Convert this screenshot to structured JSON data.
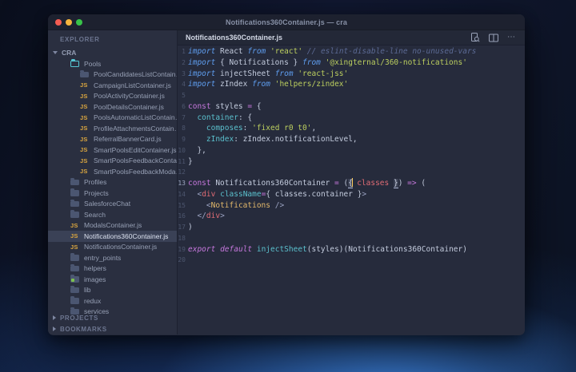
{
  "window": {
    "title": "Notifications360Container.js — cra"
  },
  "sidebar": {
    "header": "EXPLORER",
    "root": "CRA",
    "items": [
      {
        "label": "Pools",
        "icon": "folder-open",
        "level": 3
      },
      {
        "label": "PoolCandidatesListContain…",
        "icon": "folder",
        "level": 4
      },
      {
        "label": "CampaignListContainer.js",
        "icon": "js",
        "level": 4
      },
      {
        "label": "PoolActivityContainer.js",
        "icon": "js",
        "level": 4
      },
      {
        "label": "PoolDetailsContainer.js",
        "icon": "js",
        "level": 4
      },
      {
        "label": "PoolsAutomaticListContain…",
        "icon": "js",
        "level": 4
      },
      {
        "label": "ProfileAttachmentsContain…",
        "icon": "js",
        "level": 4
      },
      {
        "label": "ReferralBannerCard.js",
        "icon": "js",
        "level": 4
      },
      {
        "label": "SmartPoolsEditContainer.js",
        "icon": "js",
        "level": 4
      },
      {
        "label": "SmartPoolsFeedbackConta…",
        "icon": "js",
        "level": 4
      },
      {
        "label": "SmartPoolsFeedbackModa…",
        "icon": "js",
        "level": 4
      },
      {
        "label": "Profiles",
        "icon": "folder",
        "level": 3
      },
      {
        "label": "Projects",
        "icon": "folder",
        "level": 3
      },
      {
        "label": "SalesforceChat",
        "icon": "folder",
        "level": 3
      },
      {
        "label": "Search",
        "icon": "folder",
        "level": 3
      },
      {
        "label": "ModalsContainer.js",
        "icon": "js",
        "level": 3
      },
      {
        "label": "Notifications360Container.js",
        "icon": "js",
        "level": 3,
        "selected": true
      },
      {
        "label": "NotificationsContainer.js",
        "icon": "js",
        "level": 3
      },
      {
        "label": "entry_points",
        "icon": "folder",
        "level": 2
      },
      {
        "label": "helpers",
        "icon": "folder",
        "level": 2
      },
      {
        "label": "images",
        "icon": "folder-image",
        "level": 2
      },
      {
        "label": "lib",
        "icon": "folder",
        "level": 2
      },
      {
        "label": "redux",
        "icon": "folder",
        "level": 2
      },
      {
        "label": "services",
        "icon": "folder",
        "level": 2
      }
    ],
    "sections": [
      {
        "label": "PROJECTS"
      },
      {
        "label": "BOOKMARKS"
      }
    ]
  },
  "tabbar": {
    "tab": "Notifications360Container.js",
    "more_icon_glyph": "⋯"
  },
  "editor": {
    "active_line": 13,
    "lines": [
      {
        "num": 1,
        "tokens": [
          [
            "kw",
            "import"
          ],
          [
            "plain",
            " React "
          ],
          [
            "kw",
            "from"
          ],
          [
            "plain",
            " "
          ],
          [
            "str",
            "'react'"
          ],
          [
            "plain",
            " "
          ],
          [
            "com",
            "// eslint-disable-line no-unused-vars"
          ]
        ]
      },
      {
        "num": 2,
        "tokens": [
          [
            "kw",
            "import"
          ],
          [
            "plain",
            " { Notifications } "
          ],
          [
            "kw",
            "from"
          ],
          [
            "plain",
            " "
          ],
          [
            "str",
            "'@xingternal/360-notifications'"
          ]
        ]
      },
      {
        "num": 3,
        "tokens": [
          [
            "kw",
            "import"
          ],
          [
            "plain",
            " injectSheet "
          ],
          [
            "kw",
            "from"
          ],
          [
            "plain",
            " "
          ],
          [
            "str",
            "'react-jss'"
          ]
        ]
      },
      {
        "num": 4,
        "tokens": [
          [
            "kw",
            "import"
          ],
          [
            "plain",
            " zIndex "
          ],
          [
            "kw",
            "from"
          ],
          [
            "plain",
            " "
          ],
          [
            "str",
            "'helpers/zindex'"
          ]
        ]
      },
      {
        "num": 5,
        "tokens": []
      },
      {
        "num": 6,
        "tokens": [
          [
            "pur",
            "const"
          ],
          [
            "plain",
            " styles "
          ],
          [
            "op",
            "="
          ],
          [
            "plain",
            " {"
          ]
        ]
      },
      {
        "num": 7,
        "tokens": [
          [
            "plain",
            "  "
          ],
          [
            "prop",
            "container"
          ],
          [
            "plain",
            ": {"
          ]
        ]
      },
      {
        "num": 8,
        "tokens": [
          [
            "plain",
            "    "
          ],
          [
            "prop",
            "composes"
          ],
          [
            "plain",
            ": "
          ],
          [
            "str",
            "'fixed r0 t0'"
          ],
          [
            "plain",
            ","
          ]
        ]
      },
      {
        "num": 9,
        "tokens": [
          [
            "plain",
            "    "
          ],
          [
            "prop",
            "zIndex"
          ],
          [
            "plain",
            ": zIndex.notificationLevel,"
          ]
        ]
      },
      {
        "num": 10,
        "tokens": [
          [
            "plain",
            "  },"
          ]
        ]
      },
      {
        "num": 11,
        "tokens": [
          [
            "plain",
            "}"
          ]
        ]
      },
      {
        "num": 12,
        "tokens": []
      },
      {
        "num": 13,
        "tokens": [
          [
            "pur",
            "const"
          ],
          [
            "plain",
            " Notifications360Container "
          ],
          [
            "op",
            "="
          ],
          [
            "plain",
            " ("
          ],
          [
            "punctm",
            "{"
          ],
          [
            "cursor",
            ""
          ],
          [
            "red",
            " classes "
          ],
          [
            "punctm",
            "}"
          ],
          [
            "plain",
            ") "
          ],
          [
            "op",
            "=>"
          ],
          [
            "plain",
            " ("
          ]
        ]
      },
      {
        "num": 14,
        "tokens": [
          [
            "plain",
            "  "
          ],
          [
            "punct",
            "<"
          ],
          [
            "tag",
            "div"
          ],
          [
            "plain",
            " "
          ],
          [
            "prop",
            "className"
          ],
          [
            "op",
            "="
          ],
          [
            "plain",
            "{ classes.container }"
          ],
          [
            "punct",
            ">"
          ]
        ]
      },
      {
        "num": 15,
        "tokens": [
          [
            "plain",
            "    "
          ],
          [
            "punct",
            "<"
          ],
          [
            "comp",
            "Notifications"
          ],
          [
            "plain",
            " "
          ],
          [
            "punct",
            "/>"
          ]
        ]
      },
      {
        "num": 16,
        "tokens": [
          [
            "plain",
            "  "
          ],
          [
            "punct",
            "</"
          ],
          [
            "tag",
            "div"
          ],
          [
            "punct",
            ">"
          ]
        ]
      },
      {
        "num": 17,
        "tokens": [
          [
            "plain",
            ")"
          ]
        ]
      },
      {
        "num": 18,
        "tokens": []
      },
      {
        "num": 19,
        "tokens": [
          [
            "puri",
            "export"
          ],
          [
            "plain",
            " "
          ],
          [
            "puri",
            "default"
          ],
          [
            "plain",
            " "
          ],
          [
            "prop",
            "injectSheet"
          ],
          [
            "plain",
            "(styles)(Notifications360Container)"
          ]
        ]
      },
      {
        "num": 20,
        "tokens": []
      }
    ]
  }
}
